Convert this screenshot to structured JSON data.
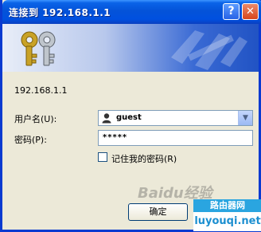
{
  "window": {
    "title": "连接到 192.168.1.1",
    "help_glyph": "?",
    "close_glyph": "✕"
  },
  "banner": {
    "left_icon": "keys-icon",
    "right_icon": "decorative-logo-icon"
  },
  "info": {
    "text": "192.168.1.1"
  },
  "form": {
    "username_label": "用户名(U):",
    "username_value": "guest",
    "user_icon": "user-icon",
    "dropdown_icon": "chevron-down-icon",
    "password_label": "密码(P):",
    "password_value": "*****",
    "remember_label": "记住我的密码(R)",
    "remember_checked": false
  },
  "buttons": {
    "ok_label": "确定"
  },
  "watermark": {
    "baidu": "Baidu经验",
    "site_top": "路由器网",
    "site_bottom": "luyouqi.net"
  },
  "colors": {
    "titlebar": "#0453d8",
    "dialog_bg": "#ece9d8",
    "watermark_blue": "#2aa5e0"
  }
}
